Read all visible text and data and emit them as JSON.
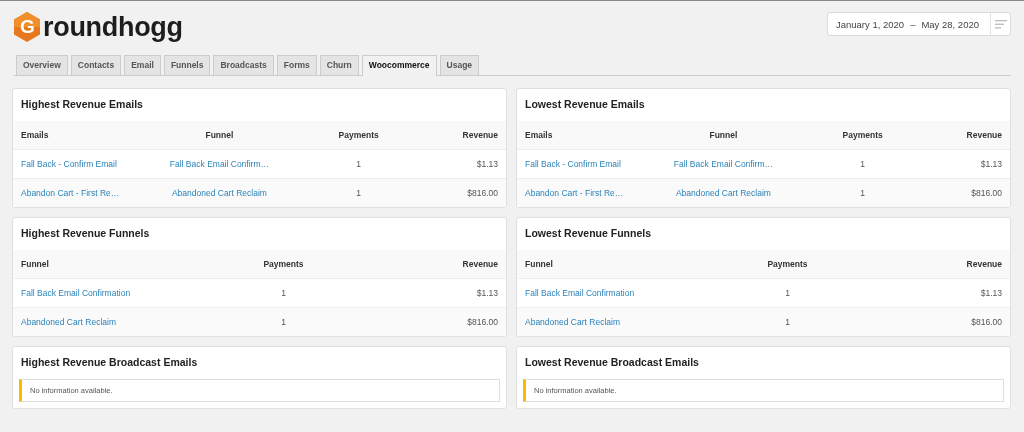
{
  "logo": {
    "mark": "G",
    "wordmark": "roundhogg"
  },
  "date_range": {
    "start": "January 1, 2020",
    "separator": "–",
    "end": "May 28, 2020"
  },
  "tabs": [
    {
      "label": "Overview",
      "selected": false
    },
    {
      "label": "Contacts",
      "selected": false
    },
    {
      "label": "Email",
      "selected": false
    },
    {
      "label": "Funnels",
      "selected": false
    },
    {
      "label": "Broadcasts",
      "selected": false
    },
    {
      "label": "Forms",
      "selected": false
    },
    {
      "label": "Churn",
      "selected": false
    },
    {
      "label": "Woocommerce",
      "selected": true
    },
    {
      "label": "Usage",
      "selected": false
    }
  ],
  "panels": [
    {
      "kind": "table",
      "title": "Highest Revenue Emails",
      "columns": [
        "Emails",
        "Funnel",
        "Payments",
        "Revenue"
      ],
      "rows": [
        [
          "Fall Back - Confirm Email",
          "Fall Back Email Confirm…",
          "1",
          "$1.13"
        ],
        [
          "Abandon Cart - First Re…",
          "Abandoned Cart Reclaim",
          "1",
          "$816.00"
        ]
      ]
    },
    {
      "kind": "table",
      "title": "Lowest Revenue Emails",
      "columns": [
        "Emails",
        "Funnel",
        "Payments",
        "Revenue"
      ],
      "rows": [
        [
          "Fall Back - Confirm Email",
          "Fall Back Email Confirm…",
          "1",
          "$1.13"
        ],
        [
          "Abandon Cart - First Re…",
          "Abandoned Cart Reclaim",
          "1",
          "$816.00"
        ]
      ]
    },
    {
      "kind": "table",
      "title": "Highest Revenue Funnels",
      "columns": [
        "Funnel",
        "Payments",
        "Revenue"
      ],
      "rows": [
        [
          "Fall Back Email Confirmation",
          "1",
          "$1.13"
        ],
        [
          "Abandoned Cart Reclaim",
          "1",
          "$816.00"
        ]
      ]
    },
    {
      "kind": "table",
      "title": "Lowest Revenue Funnels",
      "columns": [
        "Funnel",
        "Payments",
        "Revenue"
      ],
      "rows": [
        [
          "Fall Back Email Confirmation",
          "1",
          "$1.13"
        ],
        [
          "Abandoned Cart Reclaim",
          "1",
          "$816.00"
        ]
      ]
    },
    {
      "kind": "notice",
      "title": "Highest Revenue Broadcast Emails",
      "message": "No information available."
    },
    {
      "kind": "notice",
      "title": "Lowest Revenue Broadcast Emails",
      "message": "No information available."
    }
  ]
}
